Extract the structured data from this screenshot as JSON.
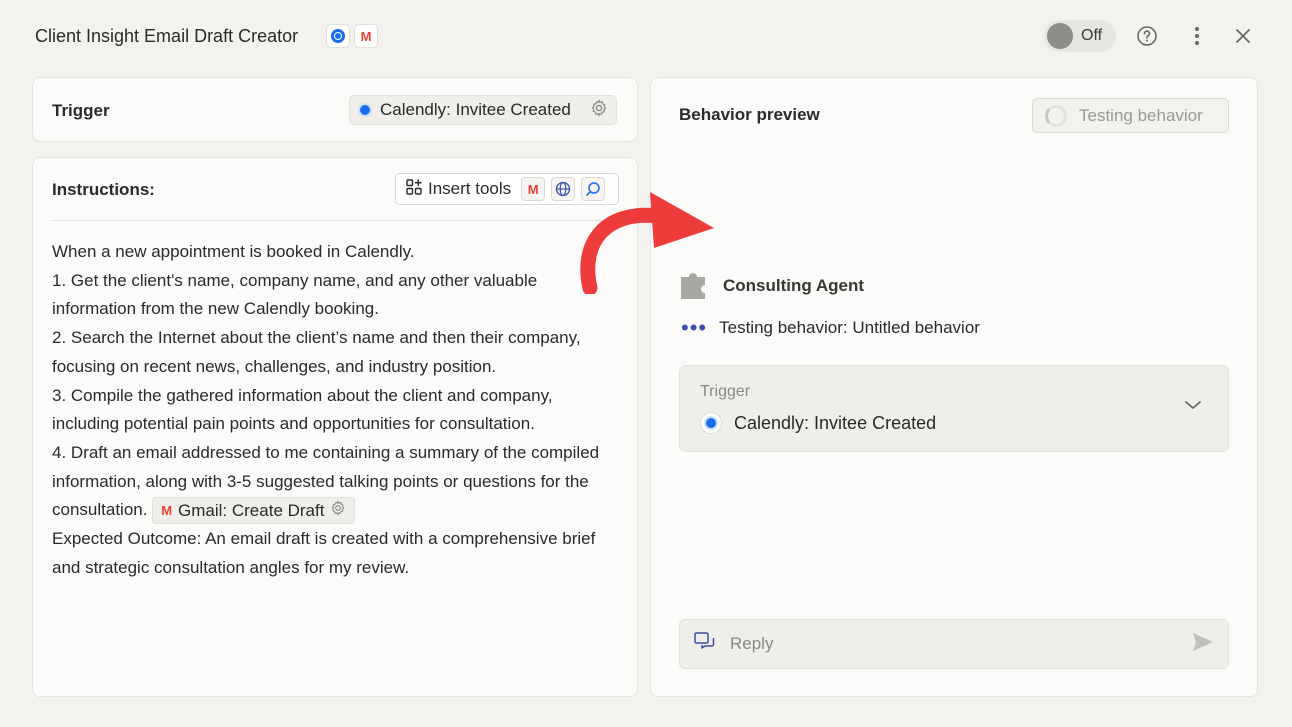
{
  "header": {
    "title": "Client Insight Email Draft Creator",
    "toggle_label": "Off"
  },
  "trigger_panel": {
    "heading": "Trigger",
    "chip_label": "Calendly: Invitee Created"
  },
  "instructions": {
    "heading": "Instructions:",
    "insert_tools_label": "Insert tools",
    "lines": [
      "When a new appointment is booked in Calendly.",
      "1. Get the client's name, company name, and any other valuable information from the new Calendly booking.",
      "2. Search the Internet about the client’s name and then their company, focusing on recent news, challenges, and industry position.",
      "3. Compile the gathered information about the client and company, including potential pain points and opportunities for consultation.",
      "4. Draft an email addressed to me containing a summary of the compiled information, along with 3-5 suggested talking points or questions for the consultation."
    ],
    "inline_tool_label": "Gmail: Create Draft",
    "outcome": "Expected Outcome: An email draft is created with a comprehensive brief and strategic consultation angles for my review."
  },
  "preview": {
    "heading": "Behavior preview",
    "testing_button_label": "Testing behavior",
    "agent_name": "Consulting Agent",
    "testing_status": "Testing behavior: Untitled behavior",
    "trigger_card": {
      "label": "Trigger",
      "value": "Calendly: Invitee Created"
    },
    "reply_placeholder": "Reply"
  },
  "colors": {
    "accent_red_arrow": "#ee3b3b",
    "calendly_blue": "#1a6cf0",
    "gmail_red": "#ea4335"
  }
}
